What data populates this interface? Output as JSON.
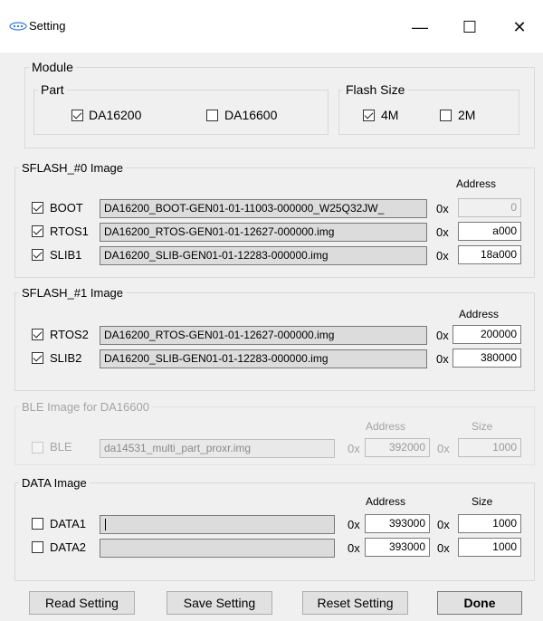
{
  "window": {
    "title": "Setting",
    "minimize_glyph": "—",
    "maximize_glyph": "☐",
    "close_glyph": "✕"
  },
  "module": {
    "legend": "Module",
    "part": {
      "legend": "Part",
      "options": [
        {
          "label": "DA16200",
          "checked": true
        },
        {
          "label": "DA16600",
          "checked": false
        }
      ]
    },
    "flash": {
      "legend": "Flash Size",
      "options": [
        {
          "label": "4M",
          "checked": true
        },
        {
          "label": "2M",
          "checked": false
        }
      ]
    }
  },
  "sflash0": {
    "legend": "SFLASH_#0 Image",
    "address_header": "Address",
    "rows": [
      {
        "label": "BOOT",
        "checked": true,
        "file": "DA16200_BOOT-GEN01-01-11003-000000_W25Q32JW_",
        "prefix": "0x",
        "address": "0",
        "address_readonly": true
      },
      {
        "label": "RTOS1",
        "checked": true,
        "file": "DA16200_RTOS-GEN01-01-12627-000000.img",
        "prefix": "0x",
        "address": "a000",
        "address_readonly": false
      },
      {
        "label": "SLIB1",
        "checked": true,
        "file": "DA16200_SLIB-GEN01-01-12283-000000.img",
        "prefix": "0x",
        "address": "18a000",
        "address_readonly": false
      }
    ]
  },
  "sflash1": {
    "legend": "SFLASH_#1 Image",
    "address_header": "Address",
    "rows": [
      {
        "label": "RTOS2",
        "checked": true,
        "file": "DA16200_RTOS-GEN01-01-12627-000000.img",
        "prefix": "0x",
        "address": "200000"
      },
      {
        "label": "SLIB2",
        "checked": true,
        "file": "DA16200_SLIB-GEN01-01-12283-000000.img",
        "prefix": "0x",
        "address": "380000"
      }
    ]
  },
  "ble": {
    "legend": "BLE Image for DA16600",
    "address_header": "Address",
    "size_header": "Size",
    "row": {
      "label": "BLE",
      "checked": false,
      "file": "da14531_multi_part_proxr.img",
      "prefix": "0x",
      "address": "392000",
      "size_prefix": "0x",
      "size": "1000"
    }
  },
  "data_image": {
    "legend": "DATA Image",
    "address_header": "Address",
    "size_header": "Size",
    "rows": [
      {
        "label": "DATA1",
        "checked": false,
        "file": "",
        "prefix": "0x",
        "address": "393000",
        "size_prefix": "0x",
        "size": "1000"
      },
      {
        "label": "DATA2",
        "checked": false,
        "file": "",
        "prefix": "0x",
        "address": "393000",
        "size_prefix": "0x",
        "size": "1000"
      }
    ]
  },
  "buttons": {
    "read": "Read Setting",
    "save": "Save Setting",
    "reset": "Reset Setting",
    "done": "Done"
  }
}
